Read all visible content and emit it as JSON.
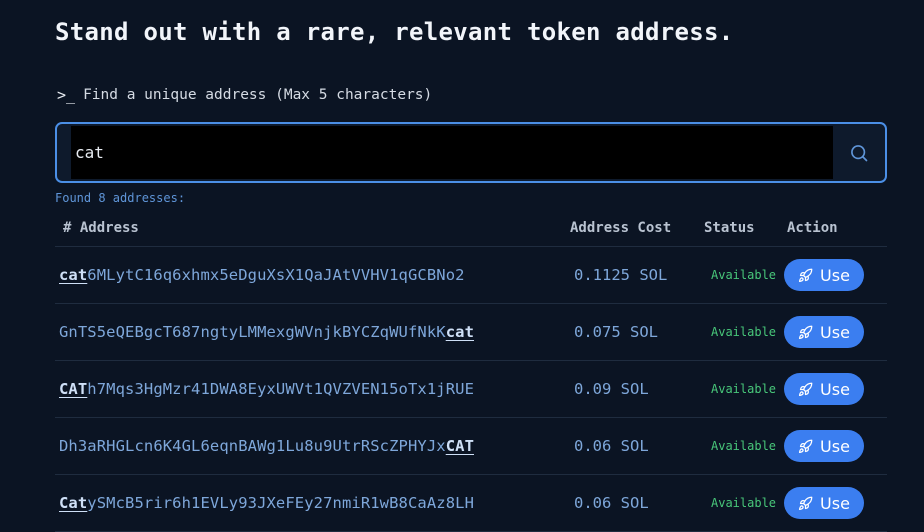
{
  "heading": "Stand out with a rare, relevant token address.",
  "prompt": {
    "symbol": ">_",
    "label": "Find a unique address (Max 5 characters)"
  },
  "search": {
    "value": "cat",
    "icon": "search-icon"
  },
  "found_text": "Found 8 addresses:",
  "table": {
    "headers": {
      "address": "# Address",
      "cost": "Address Cost",
      "status": "Status",
      "action": "Action"
    },
    "rows": [
      {
        "prefix": "",
        "match": "cat",
        "suffix": "6MLytC16q6xhmx5eDguXsX1QaJAtVVHV1qGCBNo2",
        "cost": "0.1125 SOL",
        "status": "Available",
        "action": "Use"
      },
      {
        "prefix": "GnTS5eQEBgcT687ngtyLMMexgWVnjkBYCZqWUfNkK",
        "match": "cat",
        "suffix": "",
        "cost": "0.075 SOL",
        "status": "Available",
        "action": "Use"
      },
      {
        "prefix": "",
        "match": "CAT",
        "suffix": "h7Mqs3HgMzr41DWA8EyxUWVt1QVZVEN15oTx1jRUE",
        "cost": "0.09 SOL",
        "status": "Available",
        "action": "Use"
      },
      {
        "prefix": "Dh3aRHGLcn6K4GL6eqnBAWg1Lu8u9UtrRScZPHYJx",
        "match": "CAT",
        "suffix": "",
        "cost": "0.06 SOL",
        "status": "Available",
        "action": "Use"
      },
      {
        "prefix": "",
        "match": "Cat",
        "suffix": "ySMcB5rir6h1EVLy93JXeFEy27nmiR1wB8CaAz8LH",
        "cost": "0.06 SOL",
        "status": "Available",
        "action": "Use"
      }
    ]
  },
  "colors": {
    "background": "#0b1423",
    "accent": "#3b7ef0",
    "available": "#48c77a"
  }
}
